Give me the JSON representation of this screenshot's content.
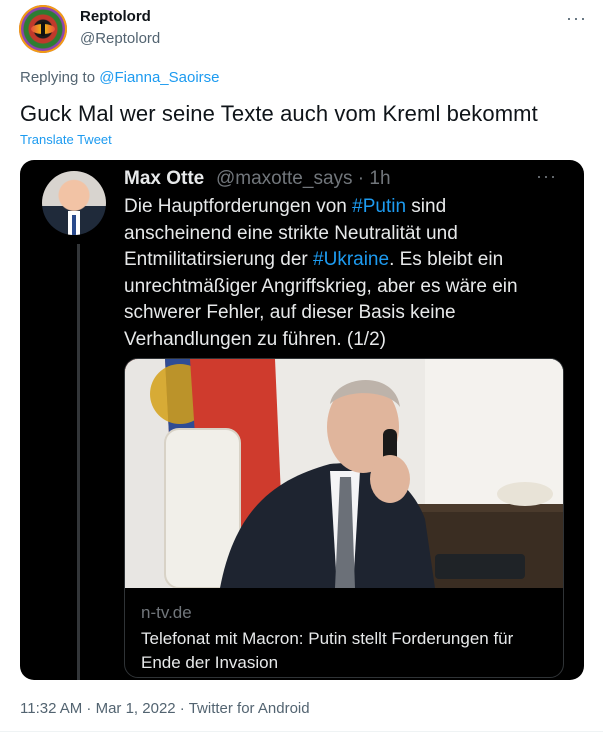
{
  "author": {
    "name": "Reptolord",
    "handle": "@Reptolord"
  },
  "more_label": "···",
  "replying": {
    "prefix": "Replying to ",
    "target": "@Fianna_Saoirse"
  },
  "tweet": {
    "text": "Guck Mal wer seine Texte auch vom Kreml bekommt",
    "translate_label": "Translate Tweet"
  },
  "quoted": {
    "name": "Max Otte",
    "handle_time": "@maxotte_says · 1h",
    "more_label": "···",
    "lines": [
      [
        "Die Hauptforderungen von ",
        "#Putin",
        " sind"
      ],
      [
        "anscheinend eine strikte Neutralität und"
      ],
      [
        "Entmilitatirsierung der ",
        "#Ukraine",
        ". Es bleibt ein"
      ],
      [
        "unrechtmäßiger Angriffskrieg, aber es wäre ein"
      ],
      [
        "schwerer Fehler, auf dieser Basis keine"
      ],
      [
        "Verhandlungen zu führen. (1/2)"
      ]
    ],
    "link_card": {
      "source": "n-tv.de",
      "title": "Telefonat mit Macron: Putin stellt Forderungen für Ende der Invasion"
    }
  },
  "footer": {
    "meta": "11:32 AM · Mar 1, 2022 · Twitter for Android"
  },
  "colors": {
    "accent": "#1d9bf0",
    "secondary_text": "#536471",
    "card_bg": "#000000"
  }
}
